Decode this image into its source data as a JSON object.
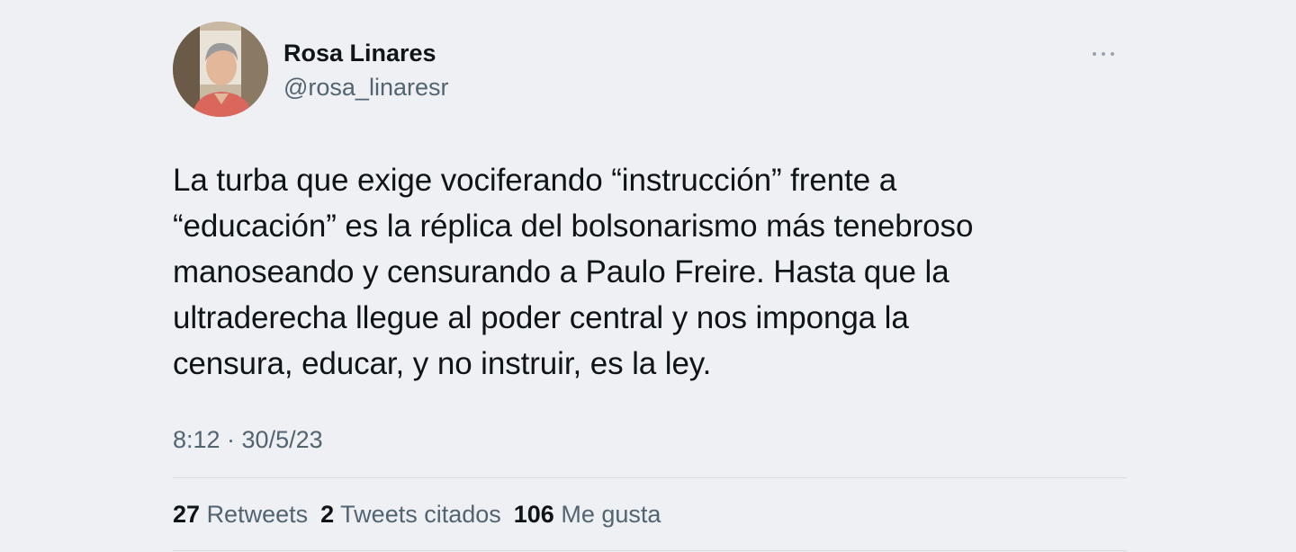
{
  "author": {
    "display_name": "Rosa Linares",
    "handle": "@rosa_linaresr"
  },
  "more_icon": "more-horizontal-icon",
  "tweet": {
    "lines": [
      "La turba que exige vociferando “instrucción” frente a",
      "“educación” es la réplica del bolsonarismo más tenebroso",
      "manoseando y censurando a Paulo Freire. Hasta que la",
      "ultraderecha llegue al poder central y nos imponga la",
      "censura, educar, y no instruir, es la ley."
    ],
    "timestamp": "8:12 · 30/5/23"
  },
  "stats": {
    "retweets_count": "27",
    "retweets_label": "Retweets",
    "quotes_count": "2",
    "quotes_label": "Tweets citados",
    "likes_count": "106",
    "likes_label": "Me gusta"
  },
  "colors": {
    "background": "#eef0f3",
    "primary_text": "#0f1419",
    "secondary_text": "#536471",
    "divider": "#d4dbe1"
  }
}
